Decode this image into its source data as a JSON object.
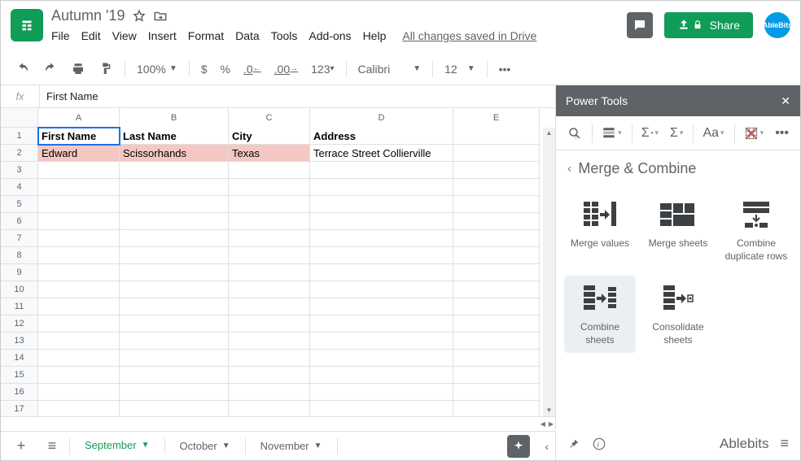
{
  "header": {
    "title": "Autumn '19",
    "menus": [
      "File",
      "Edit",
      "View",
      "Insert",
      "Format",
      "Data",
      "Tools",
      "Add-ons",
      "Help"
    ],
    "saved_status": "All changes saved in Drive",
    "share_label": "Share",
    "avatar_label": "AbleBits"
  },
  "toolbar": {
    "zoom": "100%",
    "currency": "$",
    "percent": "%",
    "dec_dec": ".0",
    "dec_inc": ".00",
    "format123": "123",
    "font": "Calibri",
    "font_size": "12"
  },
  "fx": {
    "label": "fx",
    "value": "First Name"
  },
  "grid": {
    "columns": [
      "A",
      "B",
      "C",
      "D",
      "E"
    ],
    "rows": 17,
    "headers": [
      "First Name",
      "Last Name",
      "City",
      "Address"
    ],
    "data_row": [
      "Edward",
      "Scissorhands",
      "Texas",
      "Terrace Street Collierville"
    ]
  },
  "tabs": {
    "sheets": [
      "September",
      "October",
      "November"
    ],
    "active": 0
  },
  "sidebar": {
    "title": "Power Tools",
    "panel": "Merge & Combine",
    "tools": [
      "Merge values",
      "Merge sheets",
      "Combine duplicate rows",
      "Combine sheets",
      "Consolidate sheets"
    ],
    "brand": "Ablebits"
  },
  "toolbar_text": {
    "sigma": "Σ",
    "Aa": "Aa"
  }
}
